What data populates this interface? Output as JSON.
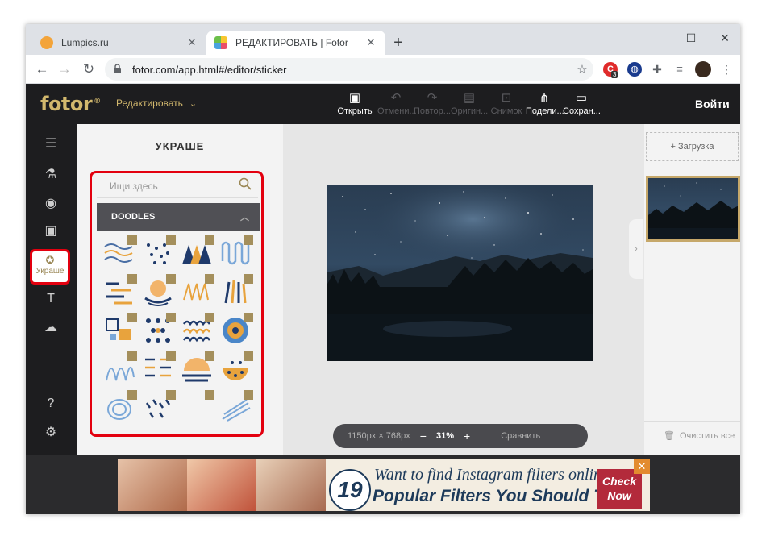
{
  "browser": {
    "tabs": [
      {
        "title": "Lumpics.ru",
        "active": false,
        "favicon_color": "#f3a43a"
      },
      {
        "title": "РЕДАКТИРОВАТЬ | Fotor",
        "active": true,
        "favicon_color": "#e94e6a"
      }
    ],
    "tab_close": "✕",
    "new_tab": "+",
    "window_controls": {
      "minimize": "—",
      "maximize": "☐",
      "close": "✕"
    },
    "nav": {
      "back": "←",
      "forward": "→",
      "reload": "↻"
    },
    "url": "fotor.com/app.html#/editor/sticker",
    "extension_badge": "3"
  },
  "app": {
    "logo": "fotor",
    "logo_mark": "®",
    "mode": "Редактировать",
    "toolbar": [
      {
        "label": "Открыть",
        "icon": "open-icon",
        "enabled": true
      },
      {
        "label": "Отмени...",
        "icon": "undo-icon",
        "enabled": false
      },
      {
        "label": "Повтор...",
        "icon": "redo-icon",
        "enabled": false
      },
      {
        "label": "Оригин...",
        "icon": "original-icon",
        "enabled": false
      },
      {
        "label": "Снимок",
        "icon": "snapshot-icon",
        "enabled": false
      },
      {
        "label": "Подели...",
        "icon": "share-icon",
        "enabled": true
      },
      {
        "label": "Сохран...",
        "icon": "save-icon",
        "enabled": true
      }
    ],
    "login": "Войти",
    "sidebar_active_label": "Украше",
    "panel": {
      "title": "УКРАШЕ",
      "search_placeholder": "Ищи здесь",
      "category": "DOODLES"
    },
    "zoom": {
      "dims": "1150px × 768px",
      "minus": "−",
      "percent": "31%",
      "plus": "+",
      "compare": "Сравнить"
    },
    "right_panel": {
      "upload": "+ Загрузка",
      "clear_all": "Очистить все"
    },
    "ad": {
      "number": "19",
      "line1": "Want to find Instagram filters online?",
      "line2": "Popular Filters You Should Try",
      "cta_line1": "Check",
      "cta_line2": "Now",
      "close": "✕"
    },
    "colors": {
      "accent_gold": "#d2b86d",
      "dark_bg": "#1d1d1f",
      "highlight_red": "#e3000f"
    }
  }
}
